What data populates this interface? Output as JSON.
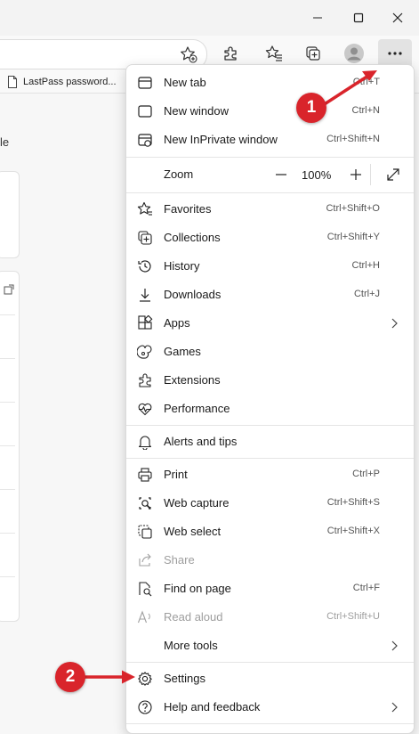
{
  "window": {
    "controls": [
      "minimize",
      "maximize",
      "close"
    ]
  },
  "toolbar": {
    "icons": [
      "add-favorite-icon",
      "extensions-icon",
      "favorites-icon",
      "collections-icon",
      "profile-avatar",
      "more-options-icon"
    ]
  },
  "favorites_bar": {
    "items": [
      {
        "label": "LastPass password..."
      }
    ]
  },
  "page": {
    "partial_text": "le"
  },
  "menu": {
    "new_tab": {
      "label": "New tab",
      "shortcut": "Ctrl+T"
    },
    "new_window": {
      "label": "New window",
      "shortcut": "Ctrl+N"
    },
    "new_inprivate": {
      "label": "New InPrivate window",
      "shortcut": "Ctrl+Shift+N"
    },
    "zoom": {
      "label": "Zoom",
      "value": "100%",
      "minus": "—",
      "plus": "+"
    },
    "favorites": {
      "label": "Favorites",
      "shortcut": "Ctrl+Shift+O"
    },
    "collections": {
      "label": "Collections",
      "shortcut": "Ctrl+Shift+Y"
    },
    "history": {
      "label": "History",
      "shortcut": "Ctrl+H"
    },
    "downloads": {
      "label": "Downloads",
      "shortcut": "Ctrl+J"
    },
    "apps": {
      "label": "Apps"
    },
    "games": {
      "label": "Games"
    },
    "extensions": {
      "label": "Extensions"
    },
    "performance": {
      "label": "Performance"
    },
    "alerts": {
      "label": "Alerts and tips"
    },
    "print": {
      "label": "Print",
      "shortcut": "Ctrl+P"
    },
    "web_capture": {
      "label": "Web capture",
      "shortcut": "Ctrl+Shift+S"
    },
    "web_select": {
      "label": "Web select",
      "shortcut": "Ctrl+Shift+X"
    },
    "share": {
      "label": "Share"
    },
    "find": {
      "label": "Find on page",
      "shortcut": "Ctrl+F"
    },
    "read_aloud": {
      "label": "Read aloud",
      "shortcut": "Ctrl+Shift+U"
    },
    "more_tools": {
      "label": "More tools"
    },
    "settings": {
      "label": "Settings"
    },
    "help": {
      "label": "Help and feedback"
    }
  },
  "annotations": {
    "step1": "1",
    "step2": "2",
    "color": "#d9242b"
  },
  "colors": {
    "menu_bg": "#ffffff",
    "chrome_bg": "#f3f3f3",
    "annotation_red": "#d9242b"
  }
}
